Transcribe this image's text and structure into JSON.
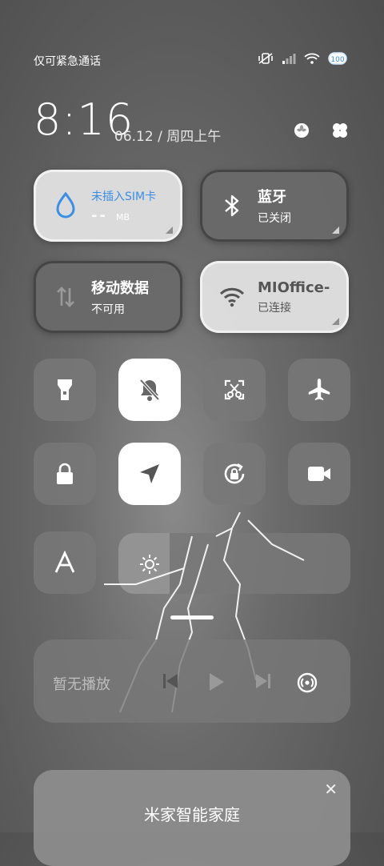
{
  "status": {
    "carrier": "仅可紧急通话",
    "icons": [
      "vibrate-off-icon",
      "signal-icon",
      "wifi-icon",
      "battery-icon"
    ],
    "battery": "100"
  },
  "clock": {
    "time": "8:16",
    "date": "06.12 / 周四上午"
  },
  "tiles": {
    "sim": {
      "title": "未插入SIM卡",
      "sub": "-- MB",
      "sub_unit": "MB",
      "sub_value": "--"
    },
    "bluetooth": {
      "title": "蓝牙",
      "sub": "已关闭"
    },
    "mobile": {
      "title": "移动数据",
      "sub": "不可用"
    },
    "wifi": {
      "title": "MIOffice-",
      "sub": "已连接"
    }
  },
  "toggles": [
    "flashlight",
    "mute",
    "screenshot",
    "airplane",
    "lock",
    "location",
    "rotation-lock",
    "video"
  ],
  "brightness": {
    "level": 0.22
  },
  "media": {
    "title": "暂无播放"
  },
  "card": {
    "title": "米家智能家庭"
  },
  "colors": {
    "accent_blue": "#3a8ee6"
  }
}
